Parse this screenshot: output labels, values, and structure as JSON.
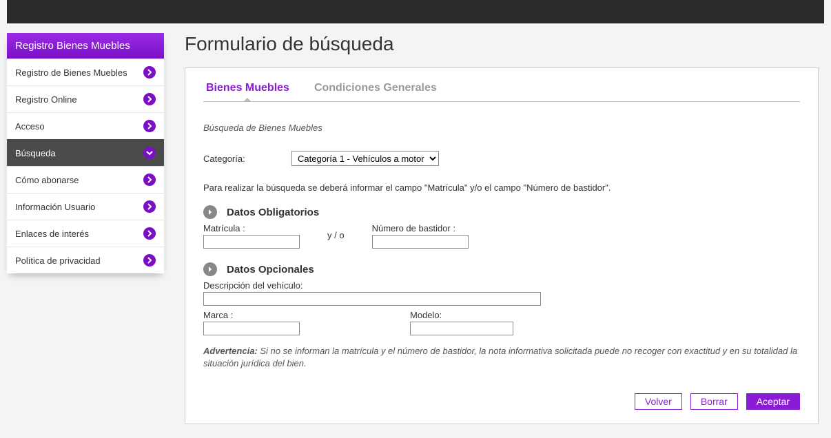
{
  "sidebar": {
    "header": "Registro Bienes Muebles",
    "items": [
      {
        "label": "Registro de Bienes Muebles",
        "active": false,
        "icon": "right"
      },
      {
        "label": "Registro Online",
        "active": false,
        "icon": "right"
      },
      {
        "label": "Acceso",
        "active": false,
        "icon": "right"
      },
      {
        "label": "Búsqueda",
        "active": true,
        "icon": "down"
      },
      {
        "label": "Cómo abonarse",
        "active": false,
        "icon": "right"
      },
      {
        "label": "Información Usuario",
        "active": false,
        "icon": "right"
      },
      {
        "label": "Enlaces de interés",
        "active": false,
        "icon": "right"
      },
      {
        "label": "Política de privacidad",
        "active": false,
        "icon": "right"
      }
    ]
  },
  "main": {
    "title": "Formulario de búsqueda",
    "tabs": [
      {
        "label": "Bienes Muebles",
        "active": true
      },
      {
        "label": "Condiciones Generales",
        "active": false
      }
    ],
    "subtitle": "Búsqueda de Bienes Muebles",
    "categoryLabel": "Categoría:",
    "categorySelected": "Categoría 1 - Vehículos a motor",
    "categoryOptions": [
      "Categoría 1 - Vehículos a motor"
    ],
    "infoText": "Para realizar la búsqueda se deberá informar el campo \"Matrícula\" y/o el campo \"Número de bastidor\".",
    "mandatory": {
      "heading": "Datos Obligatorios",
      "matriculaLabel": "Matrícula :",
      "matriculaValue": "",
      "separator": "y / o",
      "bastidorLabel": "Número de bastidor :",
      "bastidorValue": ""
    },
    "optional": {
      "heading": "Datos Opcionales",
      "descLabel": "Descripción del vehículo:",
      "descValue": "",
      "marcaLabel": "Marca :",
      "marcaValue": "",
      "modeloLabel": "Modelo:",
      "modeloValue": ""
    },
    "warning": {
      "bold": "Advertencia:",
      "text": " Si no se informan la matrícula y el número de bastidor, la nota informativa solicitada puede no recoger con exactitud y en su totalidad la situación jurídica del bien."
    },
    "buttons": {
      "back": "Volver",
      "clear": "Borrar",
      "submit": "Aceptar"
    }
  }
}
